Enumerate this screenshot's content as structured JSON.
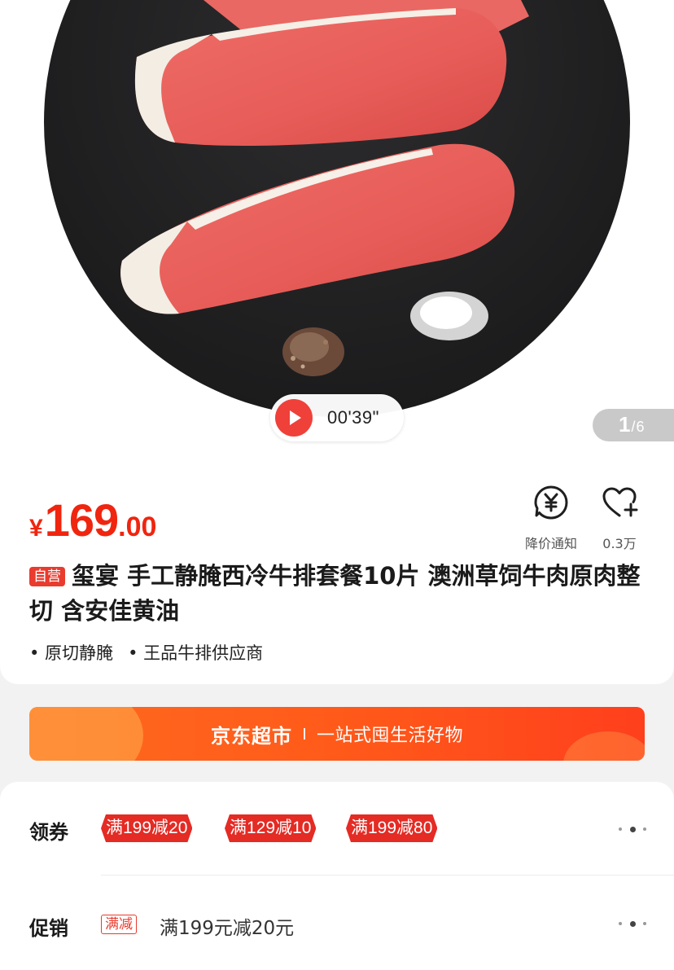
{
  "hero": {
    "video_time": "00'39\"",
    "page_indicator": {
      "current": "1",
      "separator": "/",
      "total": "6"
    }
  },
  "price": {
    "currency": "¥",
    "integer": "169",
    "decimal": ".00"
  },
  "actions": [
    {
      "icon": "yen-bell-icon",
      "label": "降价通知"
    },
    {
      "icon": "heart-plus-icon",
      "label": "0.3万"
    }
  ],
  "product": {
    "badge": "自营",
    "title": "玺宴 手工静腌西冷牛排套餐10片 澳洲草饲牛肉原肉整切 含安佳黄油",
    "tags": [
      "• 原切静腌",
      "• 王品牛排供应商"
    ]
  },
  "banner": {
    "brand": "京东超市",
    "slogan": "一站式囤生活好物"
  },
  "coupons": {
    "label": "领券",
    "items": [
      "满199减20",
      "满129减10",
      "满199减80"
    ]
  },
  "promotion": {
    "label": "促销",
    "badge": "满减",
    "text": "满199元减20元"
  },
  "colors": {
    "accent": "#f0250f",
    "banner": "#ff5a1a",
    "coupon": "#e42b24"
  }
}
